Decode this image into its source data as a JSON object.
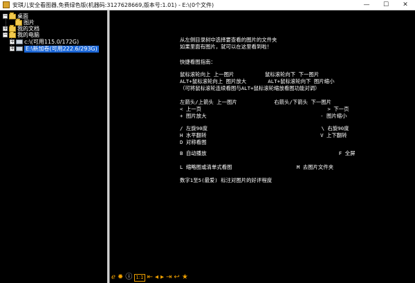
{
  "window": {
    "title": "安琪儿安全看图器,免费绿色版(机器码:3127628669,版本号:1.01) - E:\\(0个文件)",
    "minimize": "—",
    "maximize": "☐",
    "close": "✕"
  },
  "tree": {
    "items": [
      {
        "label": "桌面",
        "expander": "−"
      },
      {
        "label": "图片",
        "expander": ""
      },
      {
        "label": "我的文档",
        "expander": "+"
      },
      {
        "label": "我的电脑",
        "expander": "−"
      },
      {
        "label": "c:\\(可用115.0/172G)",
        "expander": "+"
      },
      {
        "label": "E:\\新加卷(可用222.6/293G)",
        "expander": "+"
      }
    ]
  },
  "help": {
    "line1": "从左侧目录树中选择要查看的图片的文件夹",
    "line2": "如果里面有图片，就可以在这里看到啦！",
    "line3": "快捷看图指南：",
    "line4": "鼠标滚轮向上 上一图片          鼠标滚轮向下 下一图片",
    "line5": "ALT+鼠标滚轮向上 图片放大       ALT+鼠标滚轮向下 图片缩小",
    "line6": "（可将鼠标滚轮连续看图与ALT+鼠标滚轮缩放看图功能对调）",
    "line7": "左箭头/上箭头 上一图片            右箭头/下箭头 下一图片",
    "line8": "< 上一页                                         > 下一页",
    "line9": "+ 图片放大                                     - 图片缩小",
    "line10": "/ 左旋90度                                     \\ 右旋90度",
    "line11": "H 水平翻转                                     V 上下翻转",
    "line12": "D 对称看图",
    "line13": "B 自动播放                                           F 全屏",
    "line14": "L 缩略图或清单式看图                     M 去图片文件夹",
    "line15": "数字1至5(最爱) 标注对图片的好评程度"
  },
  "toolbar": {
    "icons": [
      "e-logo-icon",
      "settings-gear-icon",
      "info-icon",
      "thumbnail-mode-icon",
      "first-icon",
      "prev-icon",
      "next-icon",
      "last-icon",
      "prev-page-icon",
      "star-icon"
    ],
    "box_label": "1:1"
  },
  "colors": {
    "background": "#000000",
    "text": "#ffffff",
    "selection": "#1b66d6",
    "toolbar_icon": "#f0a000"
  }
}
